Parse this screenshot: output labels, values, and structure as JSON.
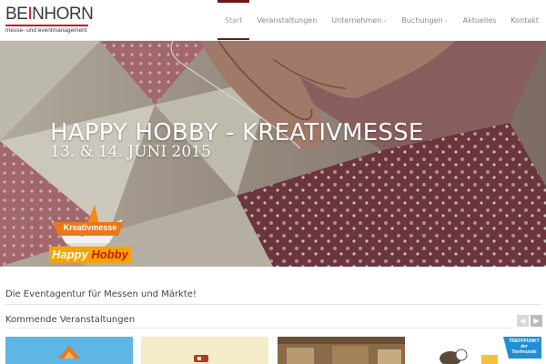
{
  "brand": {
    "logo_main_a": "BE",
    "logo_main_b": "I",
    "logo_main_c": "NHORN",
    "logo_sub": "messe- und eventmanagement"
  },
  "nav": {
    "items": [
      {
        "label": "Start",
        "active": true
      },
      {
        "label": "Veranstaltungen"
      },
      {
        "label": "Unternehmen",
        "dropdown": true
      },
      {
        "label": "Buchungen",
        "dropdown": true
      },
      {
        "label": "Aktuelles"
      },
      {
        "label": "Kontakt"
      }
    ]
  },
  "hero": {
    "title": "HAPPY HOBBY - KREATIVMESSE",
    "date": "13. & 14. JUNI 2015",
    "badge_ribbon": "Kreativmesse",
    "badge_happy": "Happy",
    "badge_hobby": "Hobby"
  },
  "content": {
    "tagline": "Die Eventagentur für Messen und Märkte!",
    "upcoming_title": "Kommende Veranstaltungen",
    "thumb_badge": "TREFFPUNKT der Tierfreunde"
  },
  "colors": {
    "accent": "#c4161c",
    "nav_active": "#6b1a1a",
    "badge_orange": "#f5a300"
  },
  "icons": {
    "prev": "chevron-left-icon",
    "next": "chevron-right-icon"
  }
}
